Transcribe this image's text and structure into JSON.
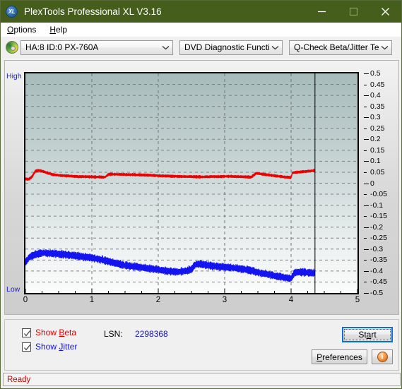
{
  "window": {
    "title": "PlexTools Professional XL V3.16",
    "icon": "XL",
    "icon_name": "plextools-logo-icon",
    "minimize_label": "minimize-icon",
    "maximize_label": "maximize-icon",
    "close_label": "close-icon",
    "titlebar_color": "#455e1b"
  },
  "menubar": {
    "items": [
      {
        "label": "Options",
        "accel": "O"
      },
      {
        "label": "Help",
        "accel": "H"
      }
    ]
  },
  "toolbar": {
    "drive_icon": "optical-disc-icon",
    "drive_select": "HA:8 ID:0  PX-760A",
    "function_select": "DVD Diagnostic Functions",
    "test_select": "Q-Check Beta/Jitter Test"
  },
  "chart_data": {
    "type": "line",
    "title": "Q-Check Beta/Jitter Test",
    "xlabel": "",
    "ylabel": "",
    "xlim": [
      0,
      5
    ],
    "ylim": [
      -0.5,
      0.5
    ],
    "grid": true,
    "axis_left_top_label": "High",
    "axis_left_bottom_label": "Low",
    "xticks": [
      0,
      1,
      2,
      3,
      4,
      5
    ],
    "xtick_labels": [
      "0",
      "1",
      "2",
      "3",
      "4",
      "5"
    ],
    "yticks": [
      0.5,
      0.45,
      0.4,
      0.35,
      0.3,
      0.25,
      0.2,
      0.15,
      0.1,
      0.05,
      0,
      -0.05,
      -0.1,
      -0.15,
      -0.2,
      -0.25,
      -0.3,
      -0.35,
      -0.4,
      -0.45,
      -0.5
    ],
    "ytick_labels": [
      "0.5",
      "0.45",
      "0.4",
      "0.35",
      "0.3",
      "0.25",
      "0.2",
      "0.15",
      "0.1",
      "0.05",
      "0",
      "-0.05",
      "-0.1",
      "-0.15",
      "-0.2",
      "-0.25",
      "-0.3",
      "-0.35",
      "-0.4",
      "-0.45",
      "-0.5"
    ],
    "data_end_x": 4.36,
    "series": [
      {
        "name": "Beta",
        "color": "#ee0000",
        "x": [
          0.0,
          0.05,
          0.1,
          0.15,
          0.2,
          0.25,
          0.3,
          0.35,
          0.4,
          0.45,
          0.5,
          0.6,
          0.7,
          0.8,
          0.9,
          1.0,
          1.1,
          1.2,
          1.25,
          1.3,
          1.4,
          1.5,
          1.6,
          1.7,
          1.8,
          1.9,
          2.0,
          2.1,
          2.2,
          2.3,
          2.4,
          2.5,
          2.6,
          2.7,
          2.8,
          2.9,
          3.0,
          3.1,
          3.2,
          3.3,
          3.4,
          3.47,
          3.5,
          3.6,
          3.7,
          3.8,
          3.9,
          4.0,
          4.02,
          4.1,
          4.2,
          4.3,
          4.36
        ],
        "y": [
          0.02,
          0.018,
          0.03,
          0.055,
          0.058,
          0.055,
          0.05,
          0.045,
          0.04,
          0.038,
          0.036,
          0.034,
          0.032,
          0.03,
          0.03,
          0.029,
          0.028,
          0.028,
          0.04,
          0.041,
          0.04,
          0.04,
          0.039,
          0.038,
          0.037,
          0.036,
          0.034,
          0.033,
          0.032,
          0.031,
          0.03,
          0.03,
          0.029,
          0.029,
          0.03,
          0.03,
          0.031,
          0.031,
          0.03,
          0.029,
          0.028,
          0.045,
          0.044,
          0.04,
          0.036,
          0.032,
          0.028,
          0.026,
          0.048,
          0.05,
          0.053,
          0.056,
          0.058
        ],
        "band": 0.012
      },
      {
        "name": "Jitter",
        "color": "#1414f0",
        "x": [
          0.0,
          0.05,
          0.1,
          0.15,
          0.2,
          0.25,
          0.3,
          0.4,
          0.5,
          0.6,
          0.7,
          0.8,
          0.9,
          1.0,
          1.1,
          1.2,
          1.3,
          1.4,
          1.5,
          1.6,
          1.7,
          1.8,
          1.9,
          2.0,
          2.1,
          2.2,
          2.3,
          2.4,
          2.5,
          2.55,
          2.6,
          2.7,
          2.8,
          2.9,
          3.0,
          3.1,
          3.2,
          3.3,
          3.4,
          3.5,
          3.6,
          3.7,
          3.8,
          3.9,
          4.0,
          4.05,
          4.1,
          4.2,
          4.3,
          4.36
        ],
        "y": [
          -0.36,
          -0.34,
          -0.33,
          -0.325,
          -0.32,
          -0.318,
          -0.318,
          -0.32,
          -0.322,
          -0.325,
          -0.328,
          -0.332,
          -0.336,
          -0.34,
          -0.345,
          -0.352,
          -0.36,
          -0.368,
          -0.374,
          -0.378,
          -0.382,
          -0.386,
          -0.39,
          -0.394,
          -0.398,
          -0.402,
          -0.404,
          -0.4,
          -0.392,
          -0.372,
          -0.368,
          -0.372,
          -0.376,
          -0.38,
          -0.382,
          -0.384,
          -0.388,
          -0.392,
          -0.398,
          -0.406,
          -0.412,
          -0.418,
          -0.424,
          -0.43,
          -0.434,
          -0.408,
          -0.404,
          -0.406,
          -0.408,
          -0.41
        ],
        "band": 0.03
      }
    ]
  },
  "controls": {
    "show_beta": {
      "label_prefix": "Show ",
      "label_accel": "B",
      "label_suffix": "eta",
      "checked": true
    },
    "show_jitter": {
      "label_prefix": "Show ",
      "label_accel": "J",
      "label_suffix": "itter",
      "checked": true
    },
    "lsn_label": "LSN:",
    "lsn_value": "2298368",
    "start_button": {
      "prefix": "St",
      "accel": "a",
      "suffix": "rt"
    },
    "preferences_button": {
      "prefix": "",
      "accel": "P",
      "suffix": "references"
    },
    "info_button": "i",
    "info_icon": "info-sphere-icon"
  },
  "status": {
    "text": "Ready",
    "color": "#cc0000"
  }
}
